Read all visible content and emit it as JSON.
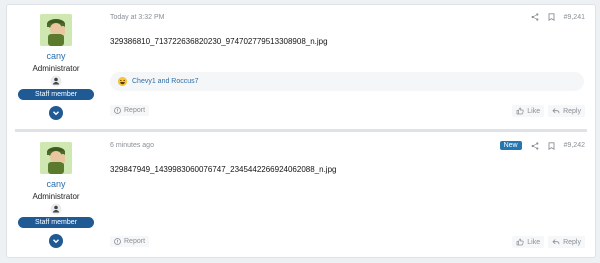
{
  "posts": [
    {
      "user": {
        "name": "cany",
        "role": "Administrator",
        "badge": "Staff member"
      },
      "date": "Today at 3:32 PM",
      "number": "#9,241",
      "content": "329386810_713722636820230_974702779513308908_n.jpg",
      "reactions": {
        "icon": "laugh-reaction-icon",
        "names": "Chevy1 and Roccus7"
      },
      "report_label": "Report",
      "like_label": "Like",
      "reply_label": "Reply"
    },
    {
      "user": {
        "name": "cany",
        "role": "Administrator",
        "badge": "Staff member"
      },
      "date": "6 minutes ago",
      "new_label": "New",
      "number": "#9,242",
      "content": "329847949_1439983060076747_2345442266924062088_n.jpg",
      "report_label": "Report",
      "like_label": "Like",
      "reply_label": "Reply"
    }
  ],
  "colors": {
    "accent": "#1f5a95",
    "link": "#2c6ea9",
    "muted": "#8a8f96",
    "new": "#2577b1"
  }
}
